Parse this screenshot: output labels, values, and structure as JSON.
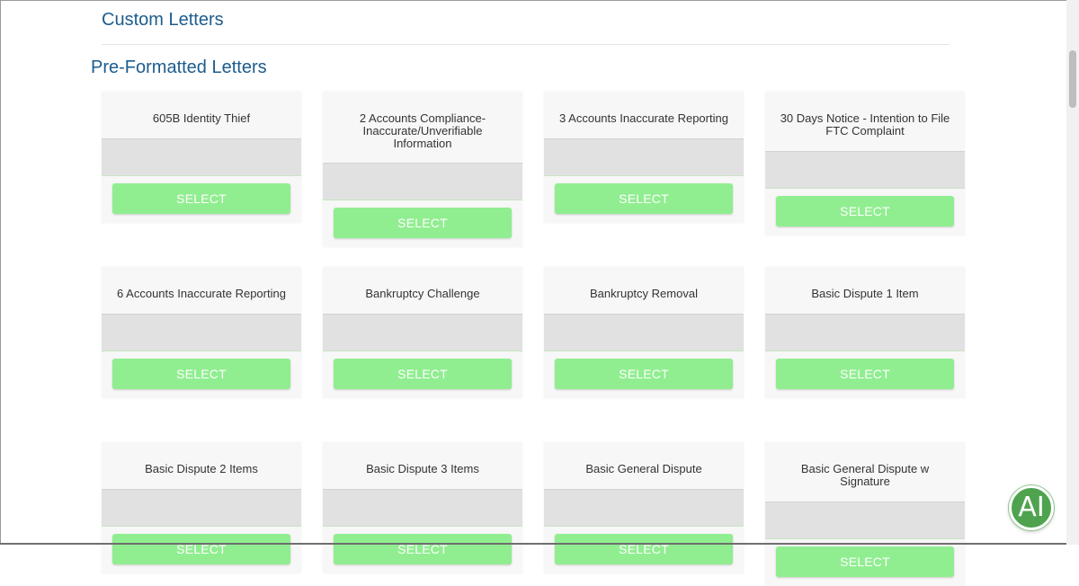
{
  "custom_section": {
    "title": "Custom Letters"
  },
  "preformatted_section": {
    "title": "Pre-Formatted Letters"
  },
  "letters": [
    {
      "title": "605B Identity Thief",
      "select_label": "SELECT"
    },
    {
      "title": "2 Accounts Compliance-Inaccurate/Unverifiable Information",
      "select_label": "SELECT"
    },
    {
      "title": "3 Accounts Inaccurate Reporting",
      "select_label": "SELECT"
    },
    {
      "title": "30 Days Notice - Intention to File FTC Complaint",
      "select_label": "SELECT"
    },
    {
      "title": "6 Accounts Inaccurate Reporting",
      "select_label": "SELECT"
    },
    {
      "title": "Bankruptcy Challenge",
      "select_label": "SELECT"
    },
    {
      "title": "Bankruptcy Removal",
      "select_label": "SELECT"
    },
    {
      "title": "Basic Dispute 1 Item",
      "select_label": "SELECT"
    },
    {
      "title": "Basic Dispute 2 Items",
      "select_label": "SELECT"
    },
    {
      "title": "Basic Dispute 3 Items",
      "select_label": "SELECT"
    },
    {
      "title": "Basic General Dispute",
      "select_label": "SELECT"
    },
    {
      "title": "Basic General Dispute w Signature",
      "select_label": "SELECT"
    }
  ],
  "assistant_badge": {
    "label": "AI",
    "icon": "ai-assistant-icon",
    "color": "#4fa34f"
  },
  "colors": {
    "heading": "#1d5c8e",
    "select_button": "#90ee90",
    "preview": "#e1e1e1"
  }
}
